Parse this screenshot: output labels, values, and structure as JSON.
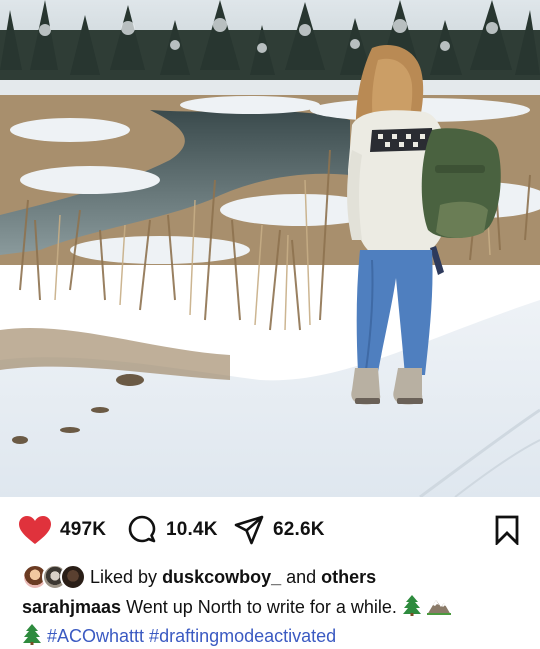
{
  "post": {
    "photo_icon": "snowy-landscape-photo",
    "actions": {
      "likes": "497K",
      "comments": "10.4K",
      "shares": "62.6K",
      "like_icon": "heart-filled",
      "comment_icon": "speech-bubble",
      "share_icon": "paper-plane",
      "save_icon": "bookmark",
      "like_color": "#e0323c"
    },
    "liked_by": {
      "prefix": "Liked by",
      "user": "duskcowboy_",
      "middle": "and",
      "suffix": "others"
    },
    "caption": {
      "username": "sarahjmaas",
      "text": "Went up North to write for a while.",
      "hashtags": "#ACOwhattt #draftingmodeactivated"
    }
  }
}
